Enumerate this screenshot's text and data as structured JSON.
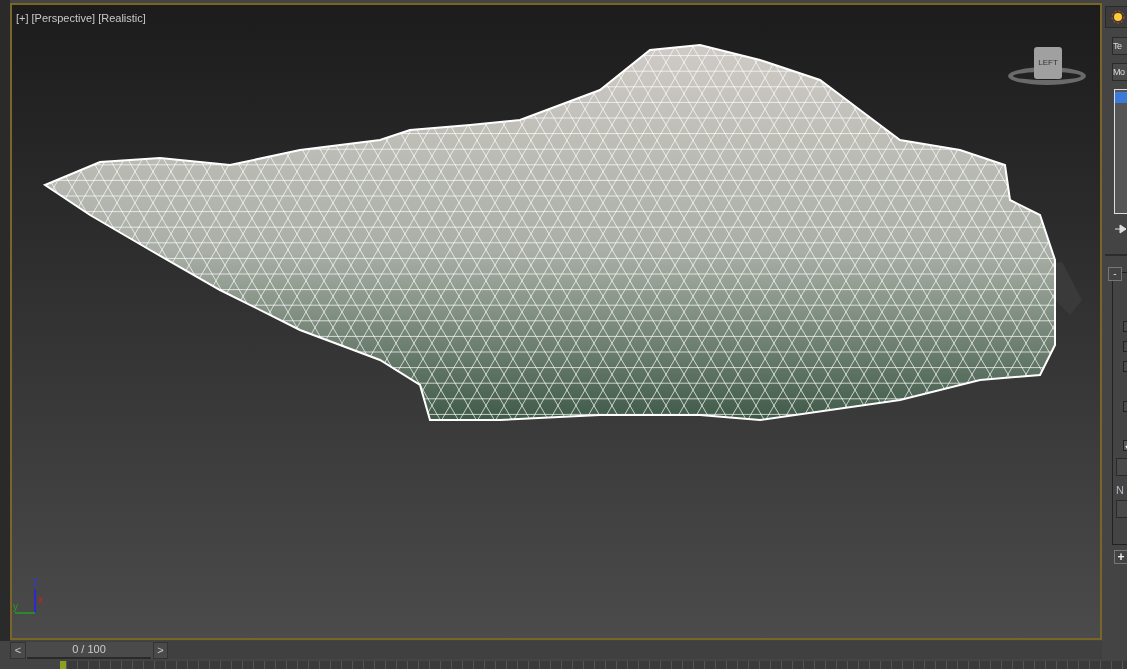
{
  "viewport": {
    "labels": [
      "[+]",
      "[Perspective]",
      "[Realistic]"
    ],
    "viewcube_label": "LEFT",
    "axes": {
      "z": "z",
      "x": "x",
      "y": "y"
    }
  },
  "command_panel": {
    "fields": [
      "Te",
      "Mo"
    ],
    "collapse_button": "-",
    "checkboxes": [
      {
        "checked": false
      },
      {
        "checked": false
      },
      {
        "checked": false
      },
      {
        "checked": false
      },
      {
        "checked": true
      }
    ],
    "label": "N",
    "expand_button": "+"
  },
  "time_slider": {
    "prev": "<",
    "frame": "0 / 100",
    "level": 0,
    "next": ">"
  }
}
